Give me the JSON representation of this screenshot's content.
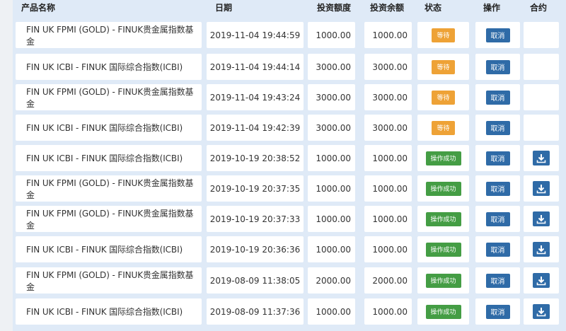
{
  "columns": {
    "name": "产品名称",
    "date": "日期",
    "amount": "投资额度",
    "balance": "投资余额",
    "status": "状态",
    "action": "操作",
    "contract": "合约"
  },
  "rows": [
    {
      "name": "FIN UK FPMI (GOLD) - FINUK贵金属指数基金",
      "date": "2019-11-04 19:44:59",
      "amount": "1000.00",
      "balance": "1000.00",
      "status": "等待",
      "status_type": "wait",
      "action": "取消",
      "download": false
    },
    {
      "name": "FIN UK ICBI - FINUK 国际综合指数(ICBI)",
      "date": "2019-11-04 19:44:14",
      "amount": "3000.00",
      "balance": "3000.00",
      "status": "等待",
      "status_type": "wait",
      "action": "取消",
      "download": false
    },
    {
      "name": "FIN UK FPMI (GOLD) - FINUK贵金属指数基金",
      "date": "2019-11-04 19:43:24",
      "amount": "3000.00",
      "balance": "3000.00",
      "status": "等待",
      "status_type": "wait",
      "action": "取消",
      "download": false
    },
    {
      "name": "FIN UK ICBI - FINUK 国际综合指数(ICBI)",
      "date": "2019-11-04 19:42:39",
      "amount": "3000.00",
      "balance": "3000.00",
      "status": "等待",
      "status_type": "wait",
      "action": "取消",
      "download": false
    },
    {
      "name": "FIN UK ICBI - FINUK 国际综合指数(ICBI)",
      "date": "2019-10-19 20:38:52",
      "amount": "1000.00",
      "balance": "1000.00",
      "status": "操作成功",
      "status_type": "ok",
      "action": "取消",
      "download": true
    },
    {
      "name": "FIN UK FPMI (GOLD) - FINUK贵金属指数基金",
      "date": "2019-10-19 20:37:35",
      "amount": "1000.00",
      "balance": "1000.00",
      "status": "操作成功",
      "status_type": "ok",
      "action": "取消",
      "download": true
    },
    {
      "name": "FIN UK FPMI (GOLD) - FINUK贵金属指数基金",
      "date": "2019-10-19 20:37:33",
      "amount": "1000.00",
      "balance": "1000.00",
      "status": "操作成功",
      "status_type": "ok",
      "action": "取消",
      "download": true
    },
    {
      "name": "FIN UK ICBI - FINUK 国际综合指数(ICBI)",
      "date": "2019-10-19 20:36:36",
      "amount": "1000.00",
      "balance": "1000.00",
      "status": "操作成功",
      "status_type": "ok",
      "action": "取消",
      "download": true
    },
    {
      "name": "FIN UK FPMI (GOLD) - FINUK贵金属指数基金",
      "date": "2019-08-09 11:38:05",
      "amount": "2000.00",
      "balance": "2000.00",
      "status": "操作成功",
      "status_type": "ok",
      "action": "取消",
      "download": true
    },
    {
      "name": "FIN UK ICBI - FINUK 国际综合指数(ICBI)",
      "date": "2019-08-09 11:37:36",
      "amount": "1000.00",
      "balance": "1000.00",
      "status": "操作成功",
      "status_type": "ok",
      "action": "取消",
      "download": true
    }
  ],
  "icons": {
    "download": "download-icon"
  },
  "colors": {
    "wait": "#eea236",
    "ok": "#449d44",
    "action": "#2f6ba7",
    "background": "#dfeaf7"
  }
}
